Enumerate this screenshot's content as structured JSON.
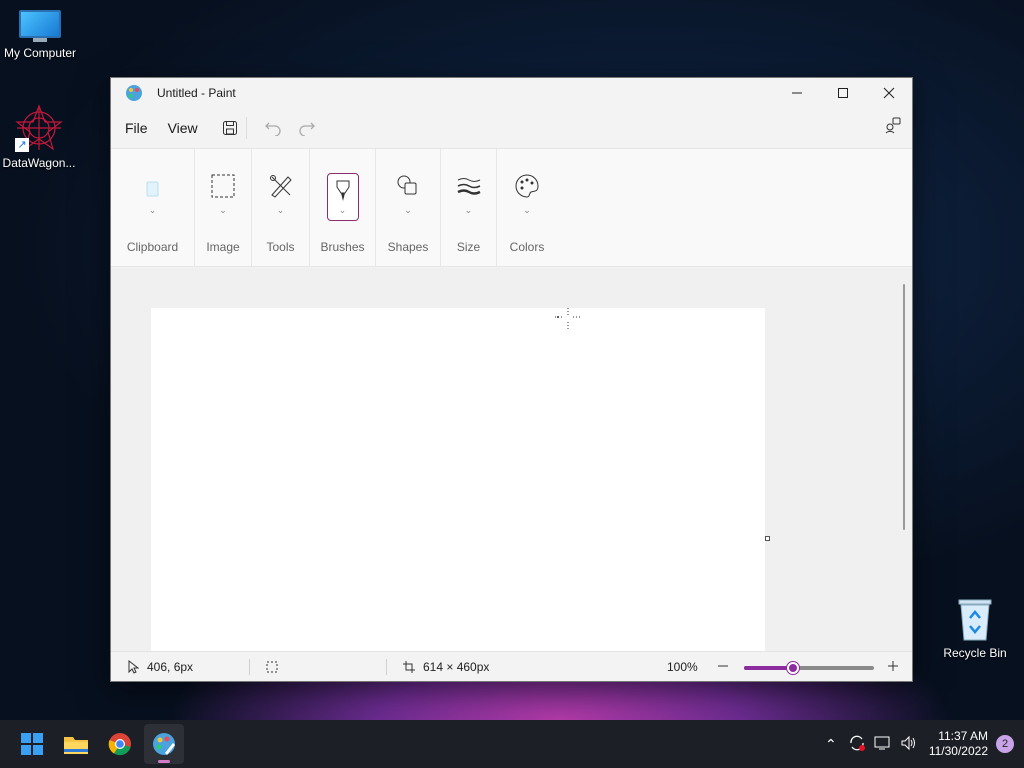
{
  "desktop": {
    "icons": [
      {
        "label": "My Computer"
      },
      {
        "label": "DataWagon..."
      },
      {
        "label": "Recycle Bin"
      }
    ]
  },
  "window": {
    "title": "Untitled - Paint",
    "menu": {
      "file": "File",
      "view": "View"
    },
    "ribbon": {
      "groups": [
        "Clipboard",
        "Image",
        "Tools",
        "Brushes",
        "Shapes",
        "Size",
        "Colors"
      ]
    },
    "status": {
      "cursor_pos": "406, 6px",
      "canvas_size": "614 × 460px",
      "zoom": "100%",
      "zoom_slider_fraction": 0.38
    }
  },
  "taskbar": {
    "apps": [
      "start-icon",
      "file-explorer-icon",
      "chrome-icon",
      "paint-icon"
    ],
    "time": "11:37 AM",
    "date": "11/30/2022",
    "notifications": "2"
  },
  "colors": {
    "accent": "#8d2c9e",
    "taskbar": "#1c1f26"
  }
}
